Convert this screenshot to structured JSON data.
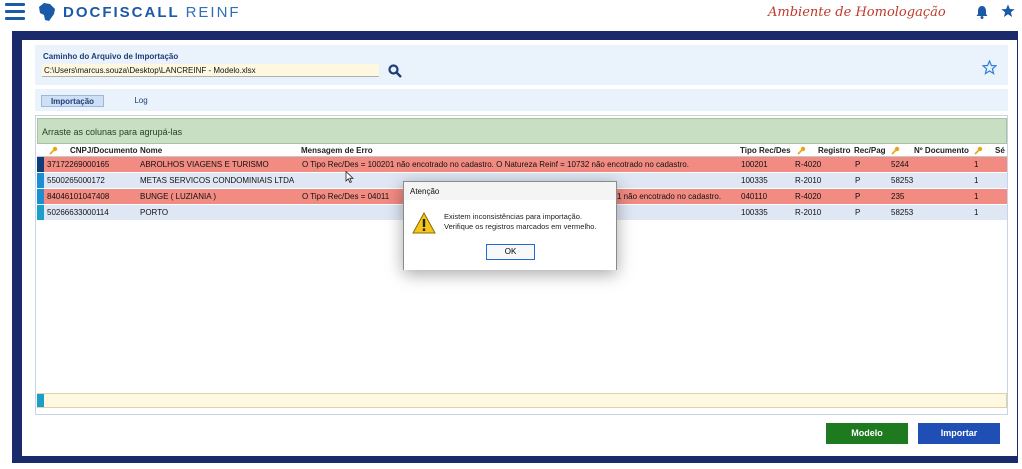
{
  "header": {
    "brand_bold": "DOCFISCALL",
    "brand_light": "REINF",
    "environment": "Ambiente de Homologação",
    "icons": [
      "menu-icon",
      "brazil-map-logo",
      "bell-icon",
      "star-icon"
    ]
  },
  "import_panel": {
    "path_label": "Caminho do Arquivo de Importação",
    "path_value": "C:\\Users\\marcus.souza\\Desktop\\LANCREINF - Modelo.xlsx"
  },
  "tabs": [
    {
      "label": "Importação",
      "active": true
    },
    {
      "label": "Log",
      "active": false
    }
  ],
  "grid": {
    "group_hint": "Arraste as colunas para agrupá-las",
    "columns": [
      "CNPJ/Documento",
      "Nome",
      "Mensagem de Erro",
      "Tipo Rec/Des",
      "Registro",
      "Rec/Pag",
      "Nº Documento",
      "Sé"
    ],
    "rows": [
      {
        "cnpj": "37172269000165",
        "nome": "ABROLHOS VIAGENS E TURISMO",
        "erro": "O Tipo Rec/Des = 100201 não encotrado no cadastro. O Natureza Reinf = 10732 não encotrado no cadastro.",
        "tipo": "100201",
        "registro": "R-4020",
        "recpag": "P",
        "documento": "5244",
        "serie": "1",
        "status": "error"
      },
      {
        "cnpj": "5500265000172",
        "nome": "METAS SERVICOS CONDOMINIAIS LTDA",
        "erro": "",
        "tipo": "100335",
        "registro": "R-2010",
        "recpag": "P",
        "documento": "58253",
        "serie": "1",
        "status": "ok"
      },
      {
        "cnpj": "84046101047408",
        "nome": "BUNGE ( LUZIANIA )",
        "erro": "O Tipo Rec/Des = 04011",
        "erro_tail": "1 não encotrado no cadastro.",
        "tipo": "040110",
        "registro": "R-4020",
        "recpag": "P",
        "documento": "235",
        "serie": "1",
        "status": "error"
      },
      {
        "cnpj": "50266633000114",
        "nome": "PORTO",
        "erro": "",
        "tipo": "100335",
        "registro": "R-2010",
        "recpag": "P",
        "documento": "58253",
        "serie": "1",
        "status": "ok"
      }
    ]
  },
  "buttons": {
    "modelo": "Modelo",
    "importar": "Importar"
  },
  "colors": {
    "frame": "#1b2a6b",
    "error_row": "#f28b82",
    "ok_row": "#dfe7f5",
    "modelo_button": "#1e7a1e",
    "importar_button": "#1f4fb5",
    "environment_text": "#c0392b"
  },
  "dialog": {
    "title": "Atenção",
    "line1": "Existem inconsistências para importação.",
    "line2": "Verifique os registros marcados em vermelho.",
    "ok_label": "OK",
    "icon": "warning-icon"
  }
}
